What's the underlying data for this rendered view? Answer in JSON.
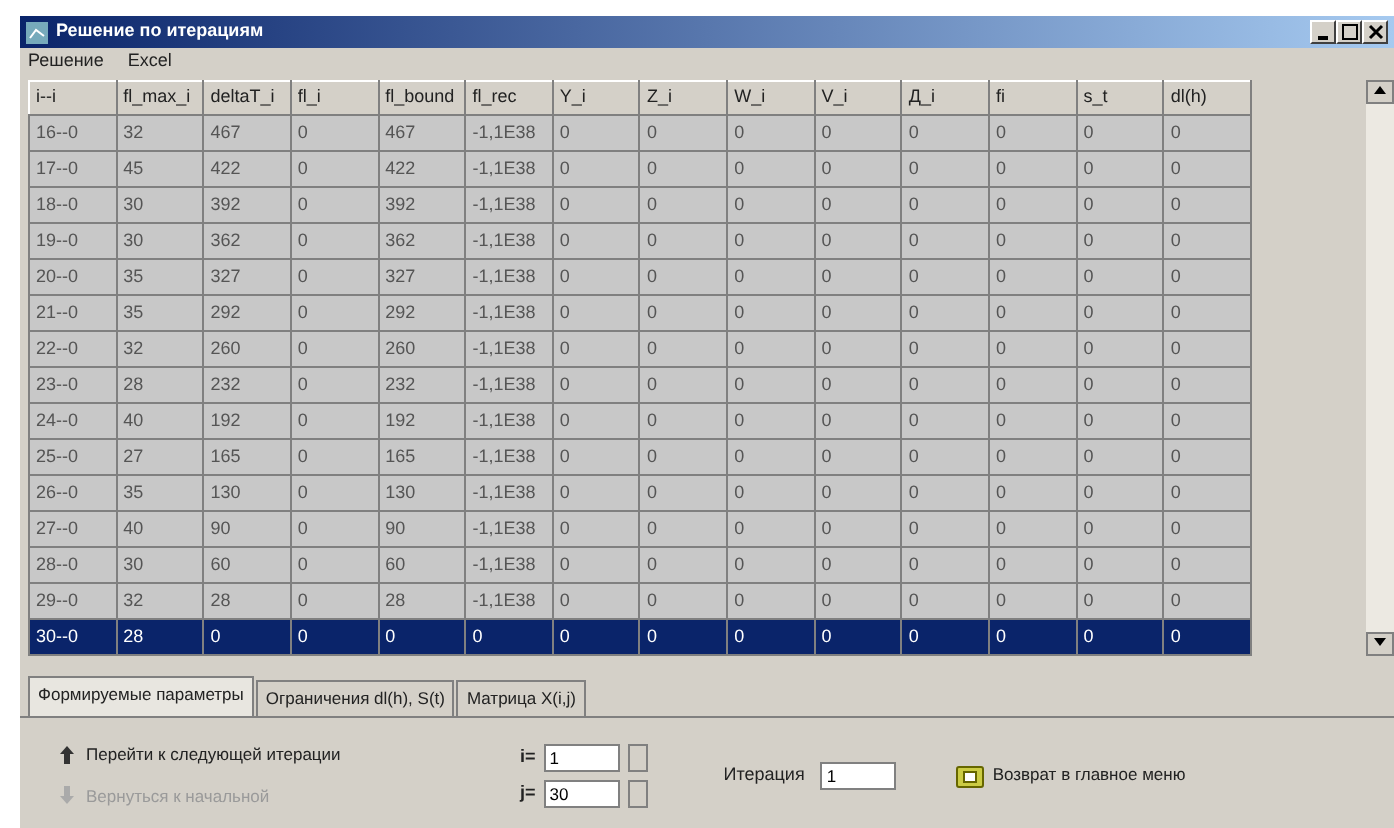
{
  "window": {
    "title": "Решение по итерациям"
  },
  "menu": [
    "Решение",
    "Excel"
  ],
  "table": {
    "columns": [
      "i--i",
      "fl_max_i",
      "deltaT_i",
      "fl_i",
      "fl_bound",
      "fl_rec",
      "Y_i",
      "Z_i",
      "W_i",
      "V_i",
      "Д_i",
      "fi",
      "s_t",
      "dl(h)"
    ],
    "rows": [
      {
        "selected": false,
        "cells": [
          "16--0",
          "32",
          "467",
          "0",
          "467",
          "-1,1E38",
          "0",
          "0",
          "0",
          "0",
          "0",
          "0",
          "0",
          "0"
        ]
      },
      {
        "selected": false,
        "cells": [
          "17--0",
          "45",
          "422",
          "0",
          "422",
          "-1,1E38",
          "0",
          "0",
          "0",
          "0",
          "0",
          "0",
          "0",
          "0"
        ]
      },
      {
        "selected": false,
        "cells": [
          "18--0",
          "30",
          "392",
          "0",
          "392",
          "-1,1E38",
          "0",
          "0",
          "0",
          "0",
          "0",
          "0",
          "0",
          "0"
        ]
      },
      {
        "selected": false,
        "cells": [
          "19--0",
          "30",
          "362",
          "0",
          "362",
          "-1,1E38",
          "0",
          "0",
          "0",
          "0",
          "0",
          "0",
          "0",
          "0"
        ]
      },
      {
        "selected": false,
        "cells": [
          "20--0",
          "35",
          "327",
          "0",
          "327",
          "-1,1E38",
          "0",
          "0",
          "0",
          "0",
          "0",
          "0",
          "0",
          "0"
        ]
      },
      {
        "selected": false,
        "cells": [
          "21--0",
          "35",
          "292",
          "0",
          "292",
          "-1,1E38",
          "0",
          "0",
          "0",
          "0",
          "0",
          "0",
          "0",
          "0"
        ]
      },
      {
        "selected": false,
        "cells": [
          "22--0",
          "32",
          "260",
          "0",
          "260",
          "-1,1E38",
          "0",
          "0",
          "0",
          "0",
          "0",
          "0",
          "0",
          "0"
        ]
      },
      {
        "selected": false,
        "cells": [
          "23--0",
          "28",
          "232",
          "0",
          "232",
          "-1,1E38",
          "0",
          "0",
          "0",
          "0",
          "0",
          "0",
          "0",
          "0"
        ]
      },
      {
        "selected": false,
        "cells": [
          "24--0",
          "40",
          "192",
          "0",
          "192",
          "-1,1E38",
          "0",
          "0",
          "0",
          "0",
          "0",
          "0",
          "0",
          "0"
        ]
      },
      {
        "selected": false,
        "cells": [
          "25--0",
          "27",
          "165",
          "0",
          "165",
          "-1,1E38",
          "0",
          "0",
          "0",
          "0",
          "0",
          "0",
          "0",
          "0"
        ]
      },
      {
        "selected": false,
        "cells": [
          "26--0",
          "35",
          "130",
          "0",
          "130",
          "-1,1E38",
          "0",
          "0",
          "0",
          "0",
          "0",
          "0",
          "0",
          "0"
        ]
      },
      {
        "selected": false,
        "cells": [
          "27--0",
          "40",
          "90",
          "0",
          "90",
          "-1,1E38",
          "0",
          "0",
          "0",
          "0",
          "0",
          "0",
          "0",
          "0"
        ]
      },
      {
        "selected": false,
        "cells": [
          "28--0",
          "30",
          "60",
          "0",
          "60",
          "-1,1E38",
          "0",
          "0",
          "0",
          "0",
          "0",
          "0",
          "0",
          "0"
        ]
      },
      {
        "selected": false,
        "cells": [
          "29--0",
          "32",
          "28",
          "0",
          "28",
          "-1,1E38",
          "0",
          "0",
          "0",
          "0",
          "0",
          "0",
          "0",
          "0"
        ]
      },
      {
        "selected": true,
        "cells": [
          "30--0",
          "28",
          "0",
          "0",
          "0",
          "0",
          "0",
          "0",
          "0",
          "0",
          "0",
          "0",
          "0",
          "0"
        ]
      }
    ]
  },
  "tabs": [
    {
      "label": "Формируемые параметры",
      "selected": true
    },
    {
      "label": "Ограничения dl(h), S(t)",
      "selected": false
    },
    {
      "label": "Матрица X(i,j)",
      "selected": false
    }
  ],
  "actions": [
    {
      "label": "Перейти к следующей итерации",
      "disabled": false
    },
    {
      "label": "Вернуться к начальной",
      "disabled": true
    }
  ],
  "indices": [
    {
      "label": "i=",
      "value": "1"
    },
    {
      "label": "j=",
      "value": "30"
    }
  ],
  "iteration": {
    "label": "Итерация",
    "value": "1"
  },
  "return_button": {
    "label": "Возврат в главное меню"
  }
}
